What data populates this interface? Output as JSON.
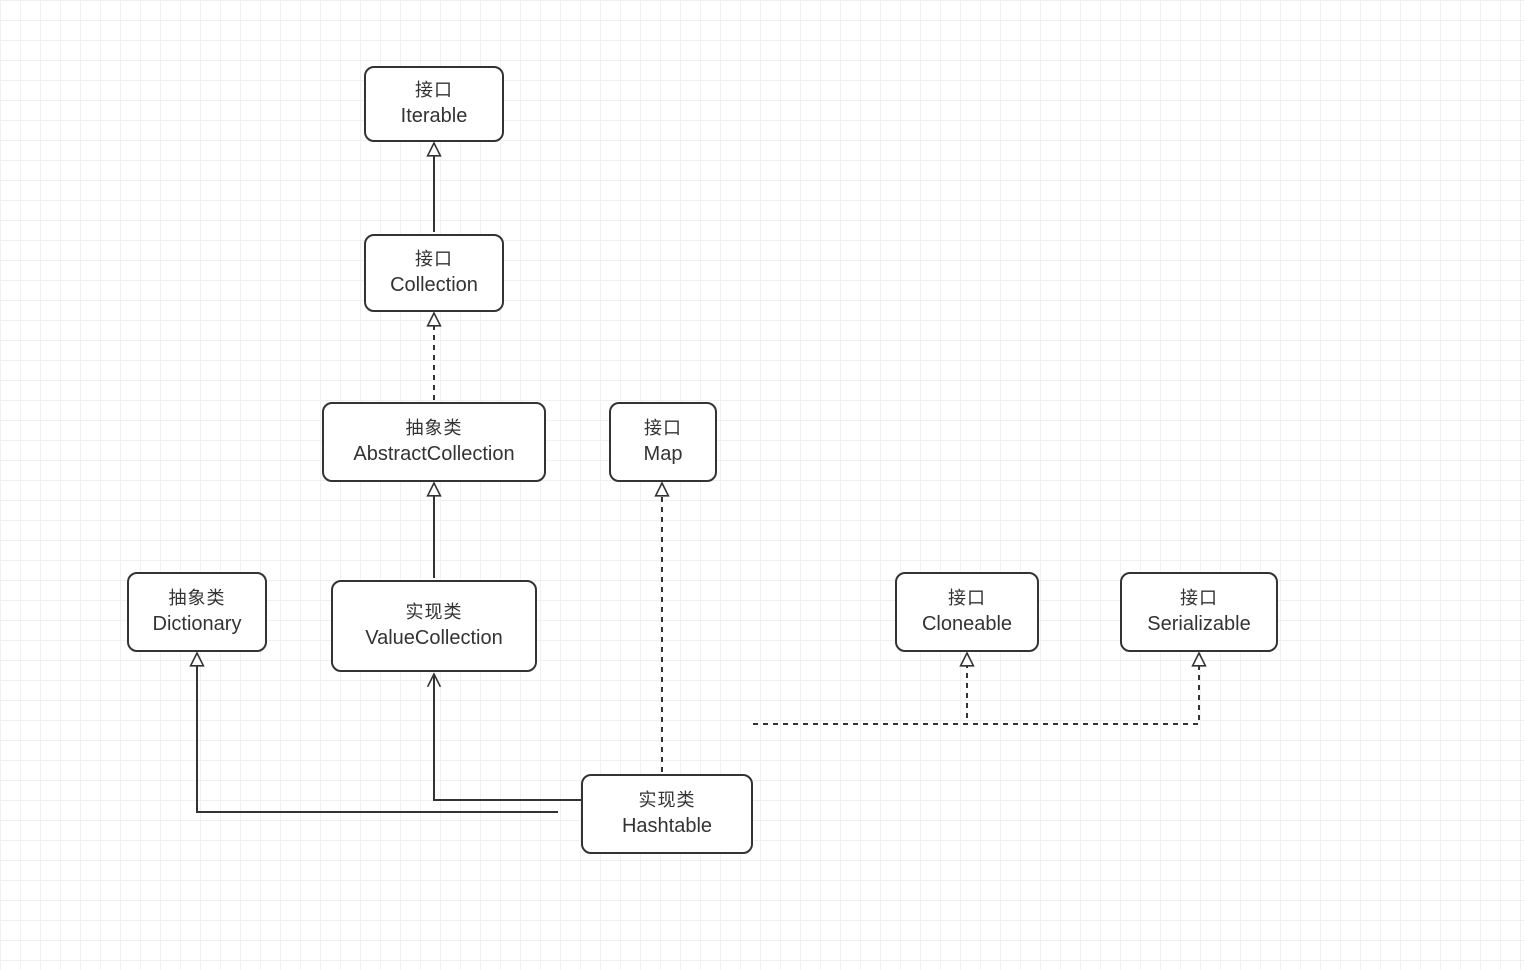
{
  "diagram": {
    "nodes": {
      "iterable": {
        "stereotype": "接口",
        "name": "Iterable"
      },
      "collection": {
        "stereotype": "接口",
        "name": "Collection"
      },
      "abstractCollection": {
        "stereotype": "抽象类",
        "name": "AbstractCollection"
      },
      "valueCollection": {
        "stereotype": "实现类",
        "name": "ValueCollection"
      },
      "map": {
        "stereotype": "接口",
        "name": "Map"
      },
      "dictionary": {
        "stereotype": "抽象类",
        "name": "Dictionary"
      },
      "cloneable": {
        "stereotype": "接口",
        "name": "Cloneable"
      },
      "serializable": {
        "stereotype": "接口",
        "name": "Serializable"
      },
      "hashtable": {
        "stereotype": "实现类",
        "name": "Hashtable"
      }
    },
    "edges": [
      {
        "from": "collection",
        "to": "iterable",
        "style": "solid",
        "head": "triangle"
      },
      {
        "from": "abstractCollection",
        "to": "collection",
        "style": "dashed",
        "head": "triangle"
      },
      {
        "from": "valueCollection",
        "to": "abstractCollection",
        "style": "solid",
        "head": "triangle"
      },
      {
        "from": "hashtable",
        "to": "valueCollection",
        "style": "solid",
        "head": "diamond-tail-arrow-head"
      },
      {
        "from": "hashtable",
        "to": "dictionary",
        "style": "solid",
        "head": "triangle"
      },
      {
        "from": "hashtable",
        "to": "map",
        "style": "dashed",
        "head": "triangle"
      },
      {
        "from": "hashtable",
        "to": "cloneable",
        "style": "dashed",
        "head": "triangle"
      },
      {
        "from": "hashtable",
        "to": "serializable",
        "style": "dashed",
        "head": "triangle"
      }
    ]
  }
}
